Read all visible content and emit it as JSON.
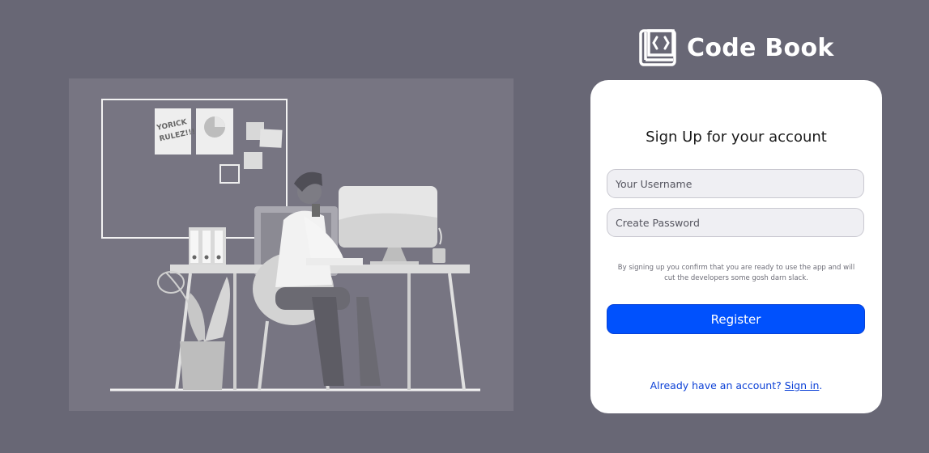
{
  "brand": {
    "name": "Code Book",
    "icon": "book-code-icon"
  },
  "illustration": {
    "sticky_note_text": "YORICK RULEZ!!!"
  },
  "signup": {
    "title": "Sign Up for your account",
    "username_placeholder": "Your Username",
    "password_placeholder": "Create Password",
    "disclaimer": "By signing up you confirm that you are ready to use the app and will cut the developers some gosh darn slack.",
    "register_label": "Register",
    "already_text": "Already have an account?",
    "signin_label": "Sign in",
    "signin_suffix": "."
  },
  "colors": {
    "background": "#686775",
    "illustration_bg": "#777582",
    "card_bg": "#ffffff",
    "accent": "#0051fd",
    "link": "#0a3fd6"
  }
}
